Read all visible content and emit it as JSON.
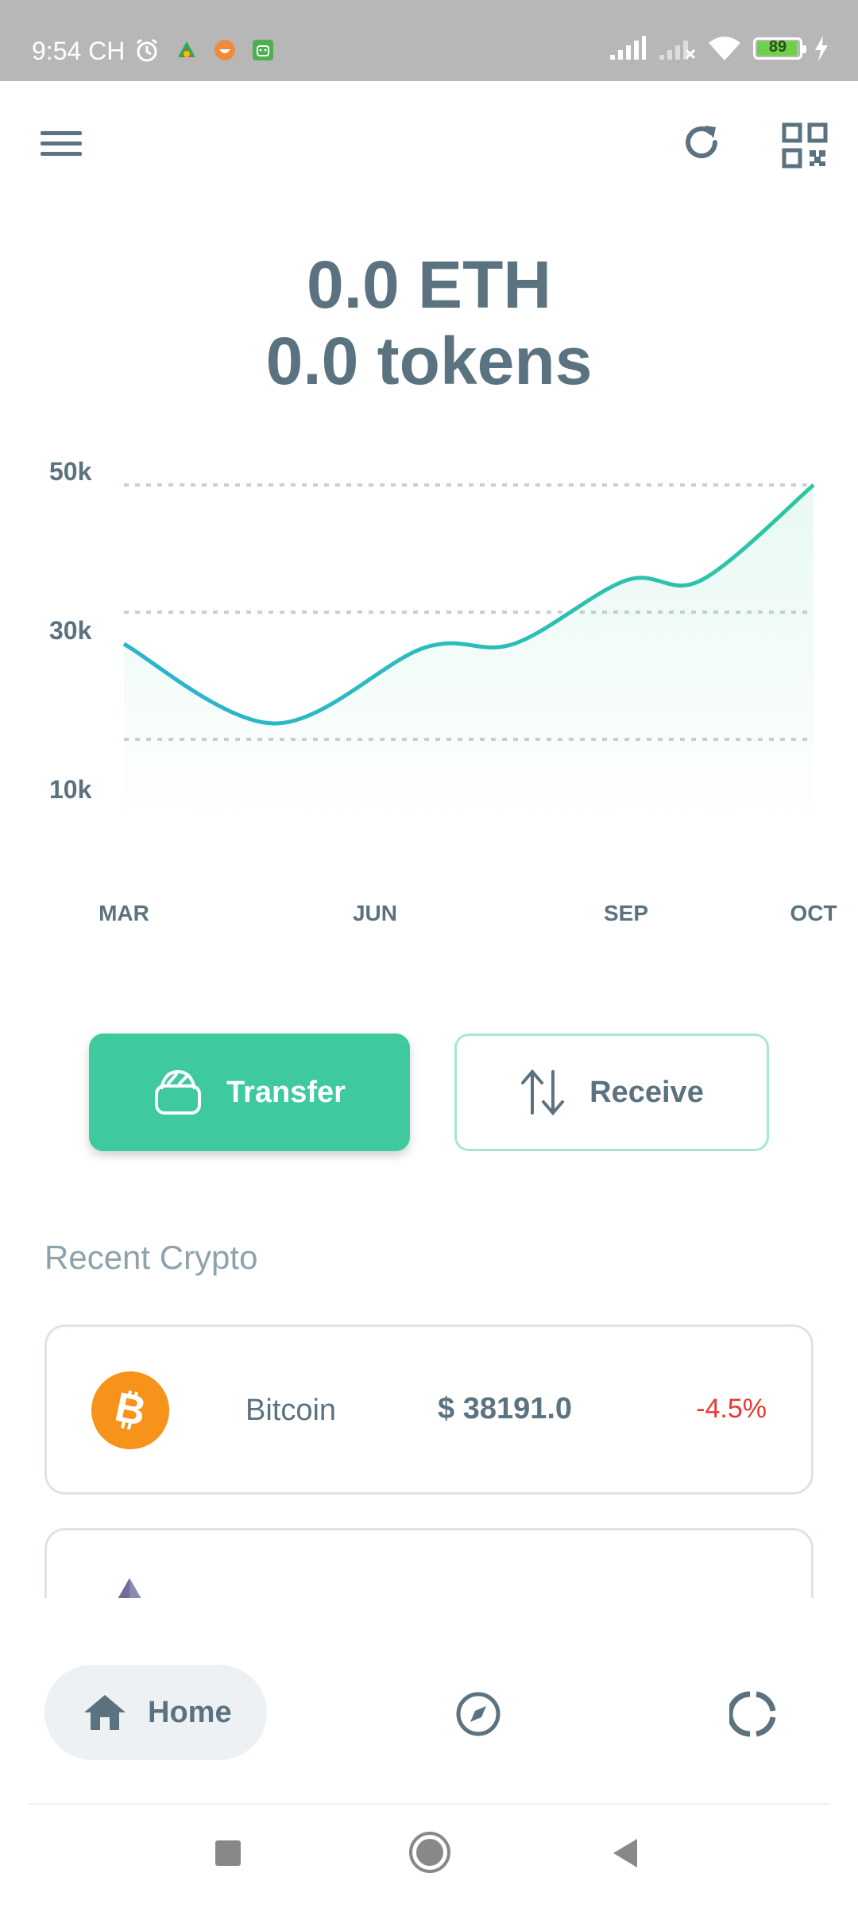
{
  "status_bar": {
    "time": "9:54 CH",
    "battery": "89",
    "icons": [
      "alarm-icon",
      "play-games-icon",
      "app-icon",
      "android-icon",
      "signal-icon",
      "wifi-icon",
      "battery-icon",
      "charging-icon"
    ]
  },
  "header": {
    "icons": [
      "menu-icon",
      "refresh-icon",
      "qr-code-icon"
    ]
  },
  "balance": {
    "eth": "0.0 ETH",
    "tokens": "0.0 tokens"
  },
  "chart_data": {
    "type": "area",
    "title": "",
    "xlabel": "",
    "ylabel": "",
    "x_tick_labels": [
      "MAR",
      "JUN",
      "SEP",
      "OCT"
    ],
    "y_tick_labels": [
      "50k",
      "30k",
      "10k"
    ],
    "points": [
      {
        "x": 0.0,
        "y": 30000
      },
      {
        "x": 1.0,
        "y": 20000
      },
      {
        "x": 2.0,
        "y": 29500
      },
      {
        "x": 2.6,
        "y": 30000
      },
      {
        "x": 3.35,
        "y": 38000
      },
      {
        "x": 3.85,
        "y": 38000
      },
      {
        "x": 4.6,
        "y": 50000
      }
    ],
    "ylim": [
      10000,
      50000
    ],
    "grid": true,
    "colors": {
      "line_start": "#2bb3d1",
      "line_end": "#2cc7a0",
      "fill": "#3ec99e"
    }
  },
  "actions": {
    "transfer_label": "Transfer",
    "receive_label": "Receive"
  },
  "recent": {
    "title": "Recent Crypto",
    "items": [
      {
        "name": "Bitcoin",
        "price": "$ 38191.0",
        "change": "-4.5%",
        "icon": "bitcoin-icon"
      },
      {
        "name": "",
        "price": "",
        "change": "",
        "icon": "ethereum-icon"
      }
    ]
  },
  "nav": {
    "home_label": "Home",
    "icons": [
      "home-icon",
      "compass-icon",
      "portfolio-icon"
    ]
  },
  "colors": {
    "accent": "#3ec99e",
    "text": "#5b7280",
    "negative": "#e53935",
    "bitcoin": "#f7931a"
  }
}
